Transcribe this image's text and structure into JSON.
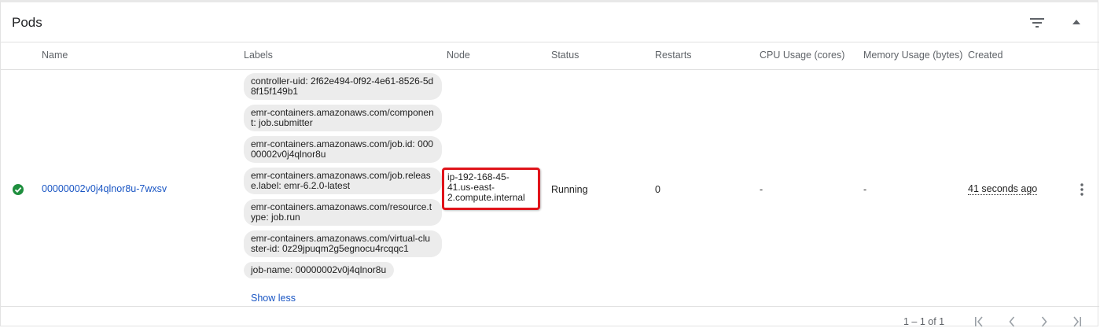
{
  "card": {
    "title": "Pods"
  },
  "columns": {
    "name": "Name",
    "labels": "Labels",
    "node": "Node",
    "status": "Status",
    "restarts": "Restarts",
    "cpu": "CPU Usage (cores)",
    "memory": "Memory Usage (bytes)",
    "created": "Created"
  },
  "row": {
    "status_icon": "check-circle-icon",
    "name": "00000002v0j4qlnor8u-7wxsv",
    "labels": [
      "controller-uid: 2f62e494-0f92-4e61-8526-5d8f15f149b1",
      "emr-containers.amazonaws.com/component: job.submitter",
      "emr-containers.amazonaws.com/job.id: 00000002v0j4qlnor8u",
      "emr-containers.amazonaws.com/job.release.label: emr-6.2.0-latest",
      "emr-containers.amazonaws.com/resource.type: job.run",
      "emr-containers.amazonaws.com/virtual-cluster-id: 0z29jpuqm2g5egnocu4rcqqc1",
      "job-name: 00000002v0j4qlnor8u"
    ],
    "show_less": "Show less",
    "node": "ip-192-168-45-41.us-east-2.compute.internal",
    "status": "Running",
    "restarts": "0",
    "cpu": "-",
    "memory": "-",
    "created": "41 seconds ago"
  },
  "pagination": {
    "range": "1 – 1 of 1"
  },
  "colors": {
    "link": "#1a56c4",
    "success": "#1e8e3e",
    "highlight": "#e0141b"
  }
}
